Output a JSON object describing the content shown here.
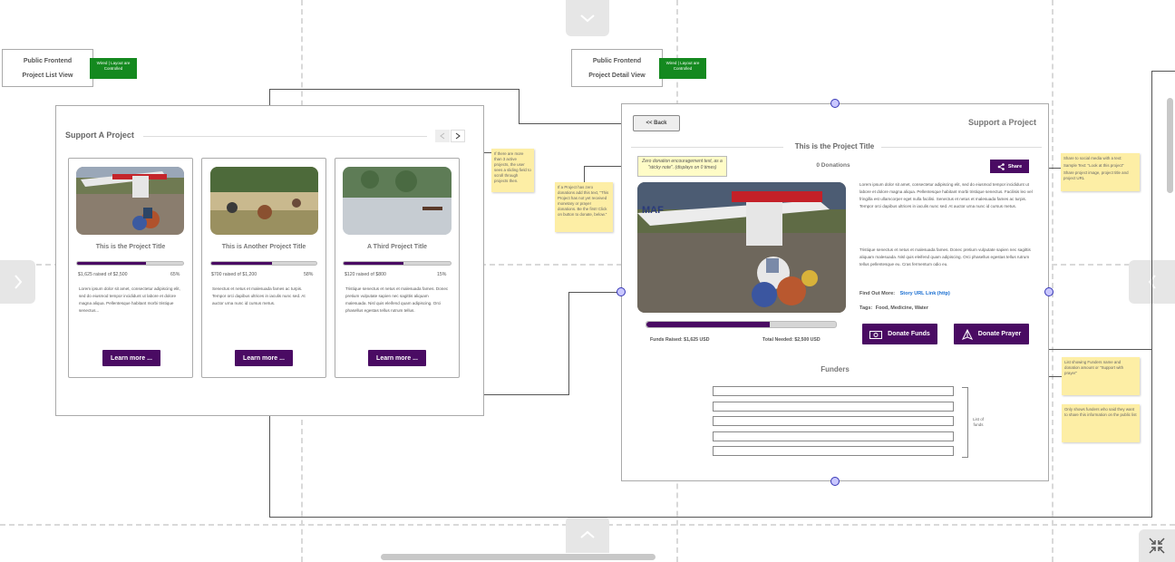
{
  "list_view": {
    "label_line1": "Public Frontend",
    "label_line2": "Project List View",
    "tag": "Wired | Layout are Controlled",
    "heading": "Support A Project",
    "cards": [
      {
        "title": "This is the Project Title",
        "raised_text": "$1,625 raised of $2,500",
        "percent_text": "65%",
        "progress": 0.65,
        "body": "Lorem ipsum dolor sit amet, consectetur adipiscing elit, sed do eiusmod tempor incididunt ut labore et dolore magna aliqua. Pellentesque habitant morbi tristique senectus...",
        "button": "Learn more ..."
      },
      {
        "title": "This is Another Project Title",
        "raised_text": "$700 raised of $1,200",
        "percent_text": "58%",
        "progress": 0.58,
        "body": "Senectus et netus et malesuada fames ac turpis. Tempor orci dapibus ultrices in iaculis nunc sed. At auctor urna nunc id cursus metus.",
        "button": "Learn more ..."
      },
      {
        "title": "A Third Project Title",
        "raised_text": "$120 raised of $800",
        "percent_text": "15%",
        "progress": 0.56,
        "body": "Tristique senectus et netus et malesuada fames. Donec pretium vulputate sapien nec sagittis aliquam malesuada. Nisl quis eleifend quam adipiscing. Orci phasellus egestas tellus rutrum tellus.",
        "button": "Learn more ..."
      }
    ],
    "note": "If there are more than 3 active projects, the user sees a sliding field to scroll through projects then."
  },
  "detail_view": {
    "label_line1": "Public Frontend",
    "label_line2": "Project Detail View",
    "tag": "Wired | Layout are Controlled",
    "back_button": "<< Back",
    "heading": "Support a Project",
    "project_title": "This is the Project Title",
    "donations": "0 Donations",
    "sticky_note": "Zero donation encouragement text, as a \"sticky note\". (displays on 0 times)",
    "share_button": "Share",
    "desc_para1": "Lorem ipsum dolor sit amet, consectetur adipiscing elit, sed do eiusmod tempor incididunt ut labore et dolore magna aliqua. Pellentesque habitant morbi tristique senectus. Facilisis leo vel fringilla est ullamcorper eget nulla facilisi. Senectus et netus et malesuada fames ac turpis. Tempor orci dapibus ultrices in iaculis nunc sed. At auctor urna nunc id cursus metus.",
    "desc_para2": "Tristique senectus et netus et malesuada fames. Donec pretium vulputate sapien nec sagittis aliquam malesuada. Nisl quis eleifend quam adipiscing. Orci phasellus egestas tellus rutrum tellus pellentesque eu. Cras fermentum odio eu.",
    "find_out_label": "Find Out More:",
    "find_out_link": "Story URL Link (http)",
    "tags_label": "Tags:",
    "tags_value": "Food, Medicine, Water",
    "funds_raised": "Funds Raised:  $1,625 USD",
    "total_needed": "Total Needed:  $2,500 USD",
    "progress": 0.65,
    "donate_funds": "Donate Funds",
    "donate_prayer": "Donate Prayer",
    "funders_heading": "Funders",
    "list_label": "List of funds",
    "note_left": "If a Project has zero donations add this text, \"This Project has not yet received monetary or prayer donations. Be the first! Click on button to donate, below.\"",
    "note_share_1": "Share to social media with a text:",
    "note_share_2": "Sample Text: \"Look at this project\"",
    "note_share_3": "Share project image, project title and project URL",
    "note_funders_1": "List showing Funders name and donation amount or \"Support with prayer\"",
    "note_funders_2": "Only shows funders who said they want to share this information on the public list"
  }
}
